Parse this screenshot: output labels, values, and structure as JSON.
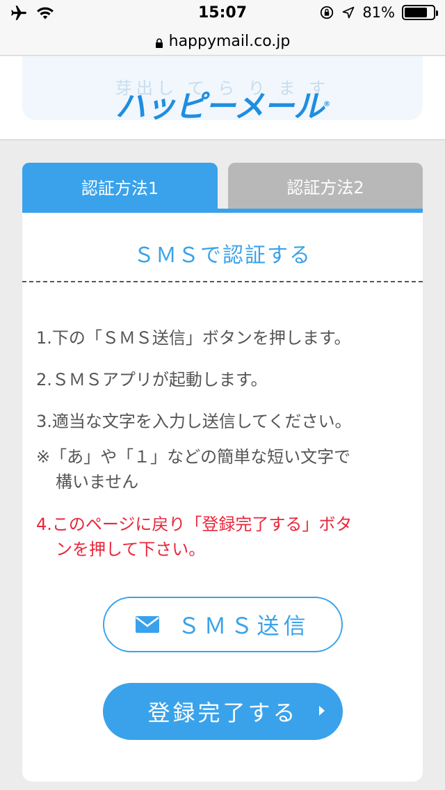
{
  "status_bar": {
    "time": "15:07",
    "battery_percent": "81%",
    "battery_level": 0.81
  },
  "url_bar": {
    "domain": "happymail.co.jp"
  },
  "header": {
    "logo_text": "ハッピーメール",
    "logo_mark": "®",
    "logo_ghost_text": "芽出し て ら り ま す"
  },
  "tabs": [
    {
      "label": "認証方法1",
      "active": true
    },
    {
      "label": "認証方法2",
      "active": false
    }
  ],
  "card": {
    "title": "ＳＭＳで認証する",
    "steps": [
      "1.下の「ＳＭＳ送信」ボタンを押します。",
      "2.ＳＭＳアプリが起動します。",
      "3.適当な文字を入力し送信してください。"
    ],
    "note_line1": "※「あ」や「１」などの簡単な短い文字で",
    "note_line2": "構いません",
    "step4_line1": "4.このページに戻り「登録完了する」ボタ",
    "step4_line2": "ンを押して下さい。",
    "sms_button_label": "ＳＭＳ送信",
    "register_button_label": "登録完了する"
  },
  "colors": {
    "accent": "#3aa2ea",
    "warning": "#e8263a",
    "inactive_tab": "#b8b8b8"
  },
  "icons": [
    "airplane-icon",
    "wifi-icon",
    "rotation-lock-icon",
    "location-arrow-icon",
    "battery-icon",
    "lock-icon",
    "mail-icon",
    "chevron-right-icon"
  ]
}
